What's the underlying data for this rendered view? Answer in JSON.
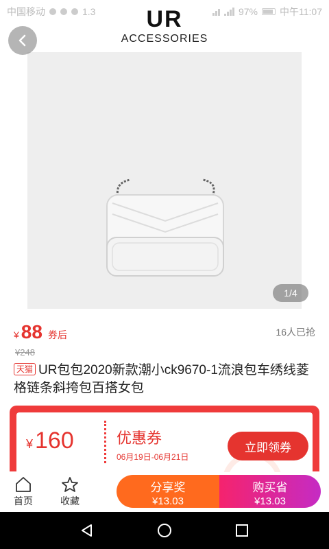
{
  "status": {
    "carrier": "中国移动",
    "speed": "1.3",
    "battery": "97%",
    "time": "中午11:07"
  },
  "brand": {
    "logo": "UR",
    "subtitle": "ACCESSORIES"
  },
  "gallery": {
    "pager": "1/4"
  },
  "product": {
    "currency": "¥",
    "price": "88",
    "price_tag": "券后",
    "sold": "16人已抢",
    "original_price": "¥248",
    "platform_badge": "天猫",
    "title": "UR包包2020新款潮小ck9670-1流浪包车绣线菱格链条斜挎包百搭女包"
  },
  "coupon": {
    "currency": "¥",
    "amount": "160",
    "name": "优惠券",
    "date_range": "06月19日-06月21日",
    "button_label": "立即领券"
  },
  "bottom_bar": {
    "home_label": "首页",
    "favorite_label": "收藏",
    "share_title": "分享奖",
    "share_value": "¥13.03",
    "buy_title": "购买省",
    "buy_value": "¥13.03"
  },
  "colors": {
    "accent_red": "#e5342f",
    "share_orange": "#ff6a1e",
    "buy_gradient_start": "#f5236d",
    "buy_gradient_end": "#c52bc4"
  }
}
